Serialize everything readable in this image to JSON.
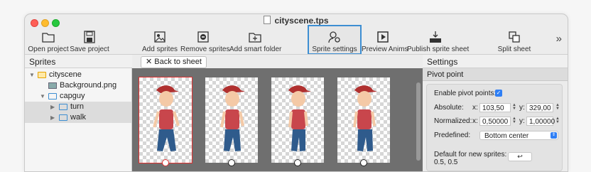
{
  "window": {
    "title": "cityscene.tps"
  },
  "toolbar": {
    "items": [
      {
        "label": "Open project",
        "icon": "folder-open-icon"
      },
      {
        "label": "Save project",
        "icon": "floppy-disk-icon"
      },
      {
        "label": "Add sprites",
        "icon": "add-image-icon"
      },
      {
        "label": "Remove sprites",
        "icon": "remove-image-icon"
      },
      {
        "label": "Add smart folder",
        "icon": "add-folder-icon"
      },
      {
        "label": "Sprite settings",
        "icon": "sprite-settings-icon",
        "selected": true
      },
      {
        "label": "Preview Anims",
        "icon": "play-icon"
      },
      {
        "label": "Publish sprite sheet",
        "icon": "publish-icon"
      },
      {
        "label": "Split sheet",
        "icon": "split-sheet-icon"
      }
    ],
    "overflow": "»"
  },
  "sprites_panel": {
    "title": "Sprites",
    "tree": [
      {
        "label": "cityscene",
        "type": "project",
        "expanded": true
      },
      {
        "label": "Background.png",
        "type": "image"
      },
      {
        "label": "capguy",
        "type": "folder",
        "expanded": true
      },
      {
        "label": "turn",
        "type": "folder",
        "selected": true
      },
      {
        "label": "walk",
        "type": "folder",
        "selected": true
      }
    ]
  },
  "canvas": {
    "back_button": "Back to sheet",
    "back_icon": "✕",
    "frame_count": 4,
    "selected_frame": 0
  },
  "settings_panel": {
    "title": "Settings",
    "section": "Pivot point",
    "enable_label": "Enable pivot points:",
    "enable_checked": true,
    "absolute_label": "Absolute:",
    "absolute_x_label": "x:",
    "absolute_x": "103,50",
    "absolute_y_label": "y:",
    "absolute_y": "329,00",
    "normalized_label": "Normalized:",
    "normalized_x_label": "x:",
    "normalized_x": "0,50000",
    "normalized_y_label": "y:",
    "normalized_y": "1,00000",
    "predefined_label": "Predefined:",
    "predefined_value": "Bottom center",
    "default_label": "Default for new sprites:",
    "default_value": "0.5, 0.5",
    "apply_button": "↩"
  },
  "colors": {
    "selection": "#3d8ed2",
    "accent": "#2f7ff5",
    "pivot_selected": "#e03030"
  }
}
